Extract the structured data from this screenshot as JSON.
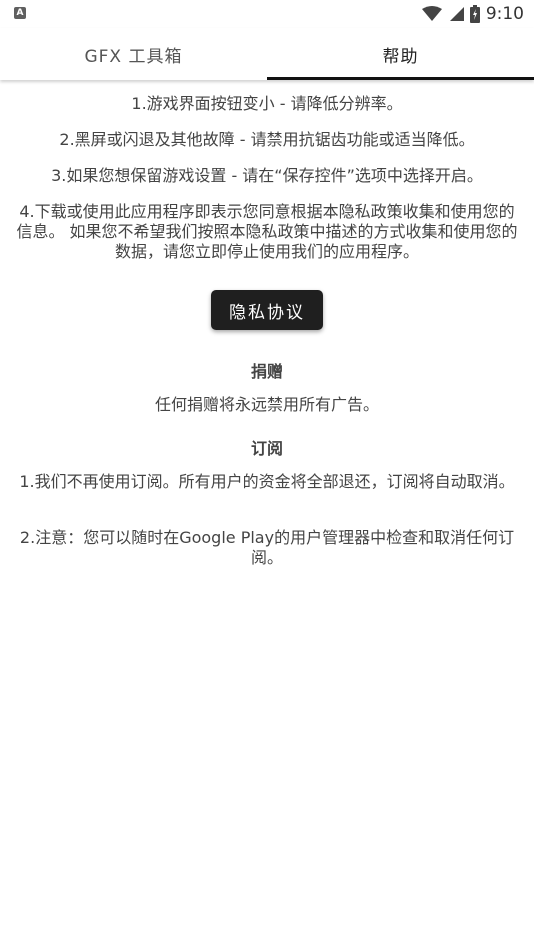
{
  "status_bar": {
    "left_icon": "A",
    "time": "9:10",
    "icons": [
      "wifi-icon",
      "signal-icon",
      "battery-icon"
    ]
  },
  "tabs": [
    {
      "label": "GFX 工具箱",
      "active": false
    },
    {
      "label": "帮助",
      "active": true
    }
  ],
  "help": {
    "items": [
      "1.游戏界面按钮变小 - 请降低分辨率。",
      "2.黑屏或闪退及其他故障 - 请禁用抗锯齿功能或适当降低。",
      "3.如果您想保留游戏设置 - 请在“保存控件”选项中选择开启。",
      "4.下载或使用此应用程序即表示您同意根据本隐私政策收集和使用您的信息。 如果您不希望我们按照本隐私政策中描述的方式收集和使用您的数据，请您立即停止使用我们的应用程序。"
    ],
    "privacy_button": "隐私协议"
  },
  "donation": {
    "title": "捐赠",
    "text": "任何捐赠将永远禁用所有广告。"
  },
  "subscription": {
    "title": "订阅",
    "items": [
      "1.我们不再使用订阅。所有用户的资金将全部退还，订阅将自动取消。",
      "2.注意：您可以随时在Google Play的用户管理器中检查和取消任何订阅。"
    ]
  }
}
